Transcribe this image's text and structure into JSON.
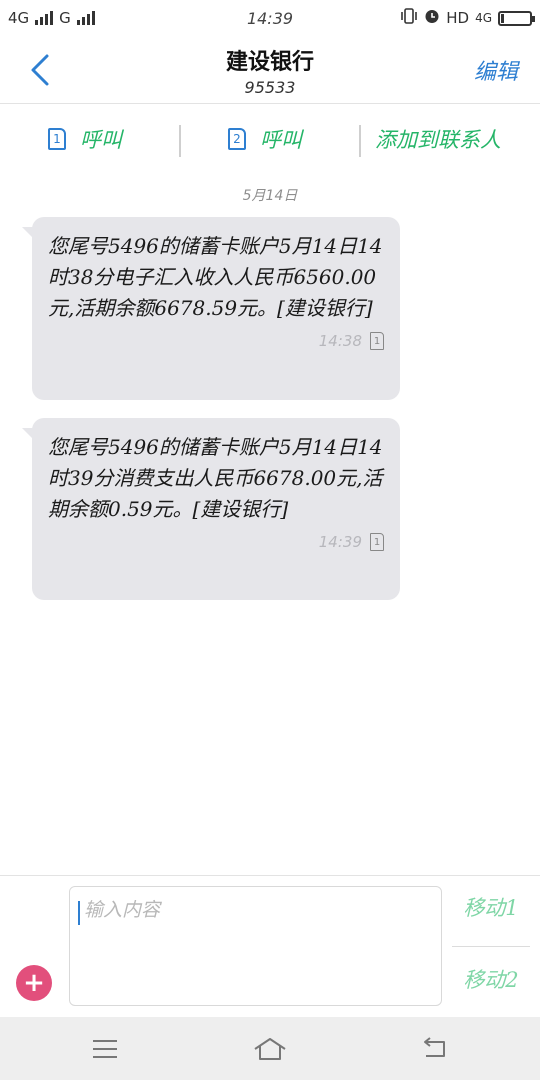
{
  "status_bar": {
    "left_net1": "4G",
    "left_net2": "G",
    "time": "14:39",
    "right_hd": "HD",
    "right_net": "4G"
  },
  "header": {
    "title": "建设银行",
    "subtitle": "95533",
    "edit_label": "编辑"
  },
  "actions": {
    "call1_sim": "1",
    "call1_label": "呼叫",
    "call2_sim": "2",
    "call2_label": "呼叫",
    "add_contact_label": "添加到联系人"
  },
  "conversation": {
    "date_separator": "5月14日",
    "messages": [
      {
        "text": "您尾号5496的储蓄卡账户5月14日14时38分电子汇入收入人民币6560.00元,活期余额6678.59元。[建设银行]",
        "time": "14:38",
        "sim": "1"
      },
      {
        "text": "您尾号5496的储蓄卡账户5月14日14时39分消费支出人民币6678.00元,活期余额0.59元。[建设银行]",
        "time": "14:39",
        "sim": "1"
      }
    ]
  },
  "composer": {
    "placeholder": "输入内容",
    "send1_label": "移动1",
    "send2_label": "移动2"
  },
  "colors": {
    "accent_blue": "#2e7fd1",
    "accent_green": "#25b568",
    "add_button": "#e24f7c",
    "bubble_bg": "#e6e6ea"
  }
}
